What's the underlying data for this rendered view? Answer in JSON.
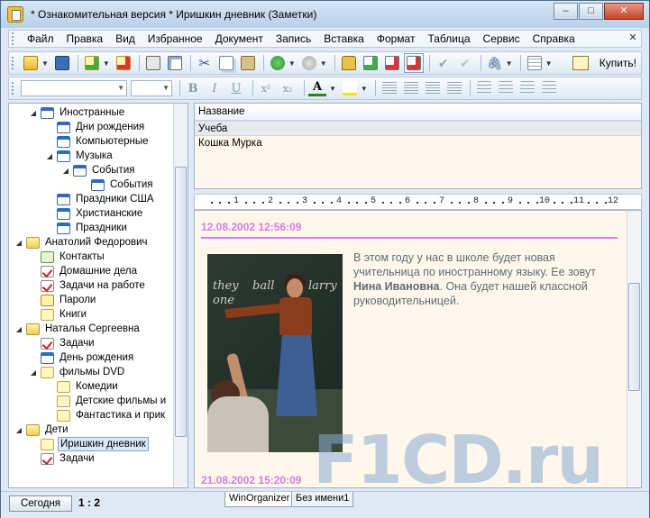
{
  "window": {
    "title": "* Ознакомительная версия * Иришкин дневник (Заметки)",
    "btn_min": "–",
    "btn_max": "□",
    "btn_close": "✕"
  },
  "menu": [
    "Файл",
    "Правка",
    "Вид",
    "Избранное",
    "Документ",
    "Запись",
    "Вставка",
    "Формат",
    "Таблица",
    "Сервис",
    "Справка"
  ],
  "toolbar": {
    "buy_label": "Купить!"
  },
  "format_toolbar": {
    "bold": "B",
    "italic": "I",
    "underline": "U",
    "superscript": "x²",
    "subscript": "x₂",
    "font_color": "A"
  },
  "tree": [
    {
      "label": "Иностранные",
      "icon": "calendar",
      "level": 1,
      "expander": "◢"
    },
    {
      "label": "Дни рождения",
      "icon": "calendar",
      "level": 2
    },
    {
      "label": "Компьютерные",
      "icon": "calendar",
      "level": 2
    },
    {
      "label": "Музыка",
      "icon": "calendar",
      "level": 2,
      "expander": "◢"
    },
    {
      "label": "События",
      "icon": "calendar",
      "level": 3,
      "expander": "◢"
    },
    {
      "label": "События",
      "icon": "calendar",
      "level": 4
    },
    {
      "label": "Праздники США",
      "icon": "calendar",
      "level": 2
    },
    {
      "label": "Христианские",
      "icon": "calendar",
      "level": 2
    },
    {
      "label": "Праздники",
      "icon": "calendar",
      "level": 2
    },
    {
      "label": "Анатолий Федорович",
      "icon": "folder",
      "level": 0,
      "expander": "◢"
    },
    {
      "label": "Контакты",
      "icon": "contact",
      "level": 1
    },
    {
      "label": "Домашние дела",
      "icon": "check",
      "level": 1
    },
    {
      "label": "Задачи на работе",
      "icon": "check",
      "level": 1
    },
    {
      "label": "Пароли",
      "icon": "key",
      "level": 1
    },
    {
      "label": "Книги",
      "icon": "note",
      "level": 1
    },
    {
      "label": "Наталья Сергеевна",
      "icon": "folder",
      "level": 0,
      "expander": "◢"
    },
    {
      "label": "Задачи",
      "icon": "check",
      "level": 1
    },
    {
      "label": "День рождения",
      "icon": "calendar",
      "level": 1
    },
    {
      "label": "фильмы DVD",
      "icon": "note",
      "level": 1,
      "expander": "◢"
    },
    {
      "label": "Комедии",
      "icon": "note",
      "level": 2
    },
    {
      "label": "Детские фильмы и",
      "icon": "note",
      "level": 2
    },
    {
      "label": "Фантастика и прик",
      "icon": "note",
      "level": 2
    },
    {
      "label": "Дети",
      "icon": "folder",
      "level": 0,
      "expander": "◢"
    },
    {
      "label": "Иришкин дневник",
      "icon": "note",
      "level": 1,
      "selected": true
    },
    {
      "label": "Задачи",
      "icon": "check",
      "level": 1
    }
  ],
  "notes_list": {
    "header": "Название",
    "rows": [
      {
        "title": "Учеба",
        "selected": true
      },
      {
        "title": "Кошка Мурка",
        "selected": false
      }
    ]
  },
  "ruler": [
    "1",
    "2",
    "3",
    "4",
    "5",
    "6",
    "7",
    "8",
    "9",
    "10",
    "11",
    "12"
  ],
  "editor": {
    "entries": [
      {
        "date": "12.08.2002 12:56:09"
      },
      {
        "date": "21.08.2002 15:20:09"
      }
    ],
    "text_before": "В этом году у нас в школе будет новая учительница по иностранному языку. Ее зовут ",
    "text_bold": "Нина Ивановна",
    "text_after": ". Она будет нашей классной руководительницей.",
    "board_words": [
      "they",
      "ball",
      "one",
      "larry"
    ]
  },
  "status": {
    "today_label": "Сегодня",
    "ratio": "1 : 2",
    "tabs": [
      "WinOrganizer",
      "Без имени1"
    ]
  },
  "watermark": "F1CD.ru",
  "colors": {
    "date_accent": "#d57be5",
    "editor_bg": "#fff8ea"
  }
}
